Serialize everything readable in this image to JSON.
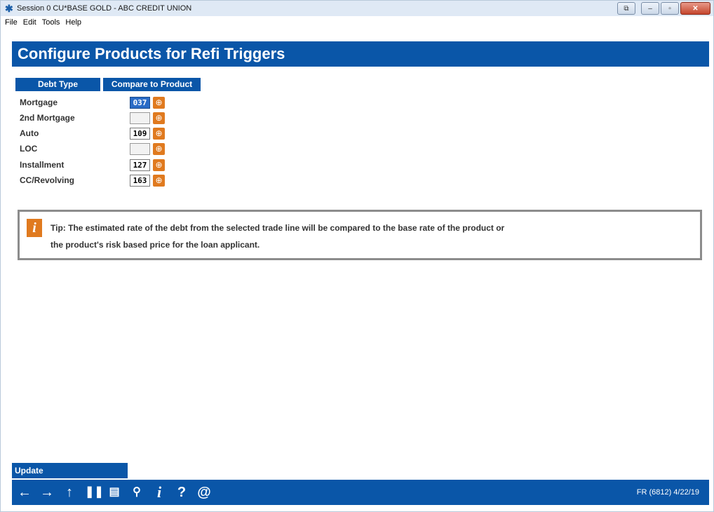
{
  "window": {
    "title": "Session 0 CU*BASE GOLD - ABC CREDIT UNION",
    "app_icon": "cubase-star-icon",
    "controls": [
      "restore-icon",
      "minimize-icon",
      "maximize-icon",
      "close-icon"
    ],
    "close_glyph": "✕",
    "restore_glyph": "⧉",
    "min_glyph": "–",
    "max_glyph": "▫"
  },
  "menu": {
    "items": [
      "File",
      "Edit",
      "Tools",
      "Help"
    ]
  },
  "page": {
    "title": "Configure Products for Refi Triggers"
  },
  "table": {
    "headers": {
      "debt_type": "Debt Type",
      "compare_to_product": "Compare to Product"
    },
    "rows": [
      {
        "label": "Mortgage",
        "value": "037",
        "selected": true
      },
      {
        "label": "2nd Mortgage",
        "value": ""
      },
      {
        "label": "Auto",
        "value": "109"
      },
      {
        "label": "LOC",
        "value": ""
      },
      {
        "label": "Installment",
        "value": "127"
      },
      {
        "label": "CC/Revolving",
        "value": "163"
      }
    ]
  },
  "tip": {
    "icon": "info-icon",
    "line1": "Tip: The estimated rate of the debt from the selected trade line will be compared to the base rate of the product or",
    "line2": "the product's risk based price for the loan applicant."
  },
  "actions": {
    "update_label": "Update"
  },
  "footer": {
    "icons": [
      "back-arrow-icon",
      "forward-arrow-icon",
      "up-arrow-icon",
      "pause-icon",
      "print-icon",
      "link-icon",
      "info-icon",
      "help-icon",
      "at-icon"
    ],
    "status": "FR (6812) 4/22/19"
  },
  "colors": {
    "brand_blue": "#0a56a8",
    "accent_orange": "#e07a1f"
  }
}
